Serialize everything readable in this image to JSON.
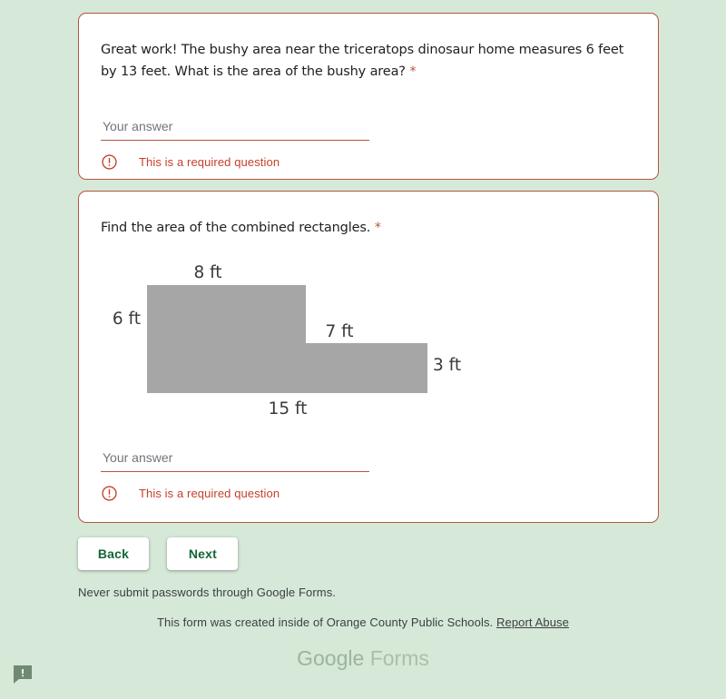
{
  "theme": {
    "page_background": "#d6e8d8",
    "card_background": "#ffffff",
    "card_border": "#b5563d",
    "accent": "#b5563d",
    "error_color": "#c5402b",
    "button_text": "#15653a",
    "figure_fill": "#a6a6a6",
    "logo_color": "#9cb49e"
  },
  "questions": [
    {
      "text": "Great work! The bushy area near the triceratops dinosaur home measures 6 feet by 13 feet. What is the area of the bushy area?",
      "required_marker": "*",
      "answer_value": "",
      "answer_placeholder": "Your answer",
      "error": "This is a required question",
      "error_icon": "error-circle-icon"
    },
    {
      "text": "Find the area of the combined rectangles.",
      "required_marker": "*",
      "answer_value": "",
      "answer_placeholder": "Your answer",
      "error": "This is a required question",
      "error_icon": "error-circle-icon"
    }
  ],
  "figure": {
    "name": "combined-rectangles-diagram",
    "shape": "L-shaped step polygon",
    "fill": "#a6a6a6",
    "labels": {
      "top_left": "8 ft",
      "left": "6 ft",
      "middle_top": "7 ft",
      "right": "3 ft",
      "bottom": "15 ft"
    }
  },
  "navigation": {
    "back_label": "Back",
    "next_label": "Next"
  },
  "footer": {
    "never_submit": "Never submit passwords through Google Forms.",
    "created_inside": "This form was created inside of Orange County Public Schools.",
    "report_abuse": "Report Abuse",
    "logo_primary": "Google",
    "logo_secondary": "Forms",
    "feedback_icon": "feedback-bubble-icon"
  }
}
